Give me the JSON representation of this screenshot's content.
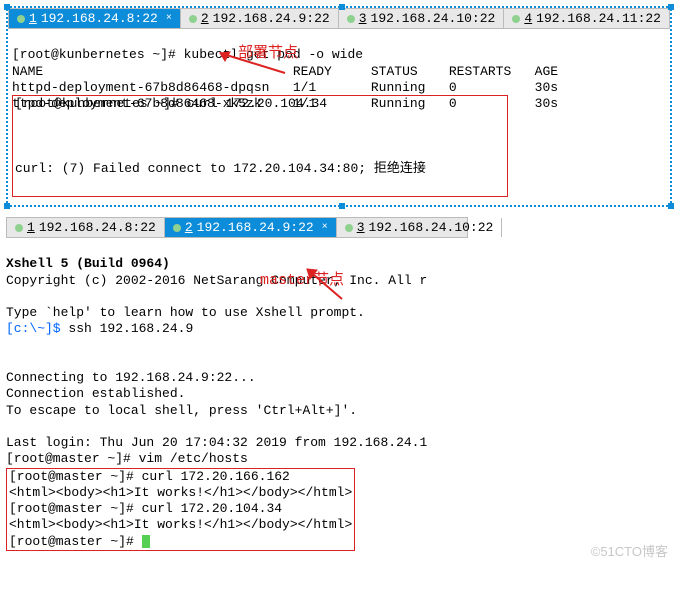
{
  "panel1": {
    "tabs": [
      {
        "num": "1",
        "ip": "192.168.24.8:22"
      },
      {
        "num": "2",
        "ip": "192.168.24.9:22"
      },
      {
        "num": "3",
        "ip": "192.168.24.10:22"
      },
      {
        "num": "4",
        "ip": "192.168.24.11:22"
      }
    ],
    "line0": "[root@kunbernetes ~]# kubectl get pod -o wide",
    "header": "NAME                                READY     STATUS    RESTARTS   AGE",
    "row1": "httpd-deployment-67b8d86468-dpqsn   1/1       Running   0          30s",
    "row2": "ttpd-deployment-67b8d86468-xk5zk    1/1       Running   0          30s",
    "curl1": "[root@kunbernetes ~]# curl 172.20.104.34",
    "curl_err": "curl: (7) Failed connect to 172.20.104.34:80; 拒绝连接",
    "annotation": "部署节点"
  },
  "panel2": {
    "tabs": [
      {
        "num": "1",
        "ip": "192.168.24.8:22"
      },
      {
        "num": "2",
        "ip": "192.168.24.9:22"
      },
      {
        "num": "3",
        "ip": "192.168.24.10:22"
      }
    ],
    "banner1": "Xshell 5 (Build 0964)",
    "banner2": "Copyright (c) 2002-2016 NetSarang Computer, Inc. All r",
    "help": "Type `help' to learn how to use Xshell prompt.",
    "prompt_local": "[c:\\~]$ ",
    "ssh_cmd": "ssh 192.168.24.9",
    "connecting": "Connecting to 192.168.24.9:22...",
    "established": "Connection established.",
    "escape": "To escape to local shell, press 'Ctrl+Alt+]'.",
    "lastlogin": "Last login: Thu Jun 20 17:04:32 2019 from 192.168.24.1",
    "vim": "[root@master ~]# vim /etc/hosts",
    "c1": "[root@master ~]# curl 172.20.166.162",
    "r1": "<html><body><h1>It works!</h1></body></html>",
    "c2": "[root@master ~]# curl 172.20.104.34",
    "r2": "<html><body><h1>It works!</h1></body></html>",
    "c3": "[root@master ~]# ",
    "annotation": "master节点"
  },
  "watermark": "©51CTO博客"
}
